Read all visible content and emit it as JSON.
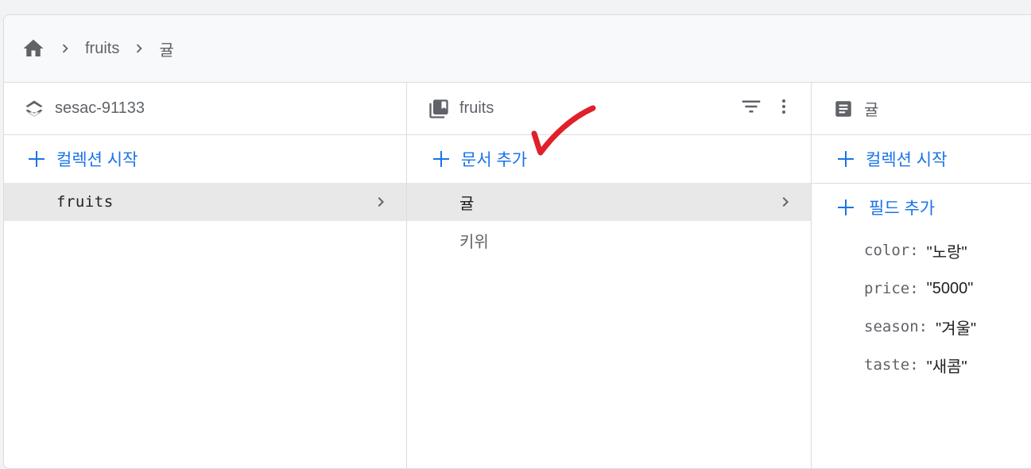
{
  "breadcrumb": {
    "items": [
      "fruits",
      "귤"
    ]
  },
  "columns": {
    "project": {
      "title": "sesac-91133",
      "add_label": "컬렉션 시작",
      "items": [
        {
          "label": "fruits",
          "selected": true
        }
      ]
    },
    "collection": {
      "title": "fruits",
      "add_label": "문서 추가",
      "items": [
        {
          "label": "귤",
          "selected": true
        },
        {
          "label": "키위",
          "selected": false
        }
      ]
    },
    "document": {
      "title": "귤",
      "add_collection_label": "컬렉션 시작",
      "add_field_label": "필드 추가",
      "fields": [
        {
          "key": "color:",
          "value": "\"노랑\""
        },
        {
          "key": "price:",
          "value": "\"5000\""
        },
        {
          "key": "season:",
          "value": "\"겨울\""
        },
        {
          "key": "taste:",
          "value": "\"새콤\""
        }
      ]
    }
  },
  "colors": {
    "accent": "#1a73e8",
    "annotation": "#e0202a",
    "selected_bg": "#e8e8e8"
  },
  "icons": [
    "home-icon",
    "chevron-right-icon",
    "layers-icon",
    "collection-icon",
    "filter-icon",
    "more-vert-icon",
    "document-icon",
    "plus-icon",
    "checkmark-annotation"
  ]
}
